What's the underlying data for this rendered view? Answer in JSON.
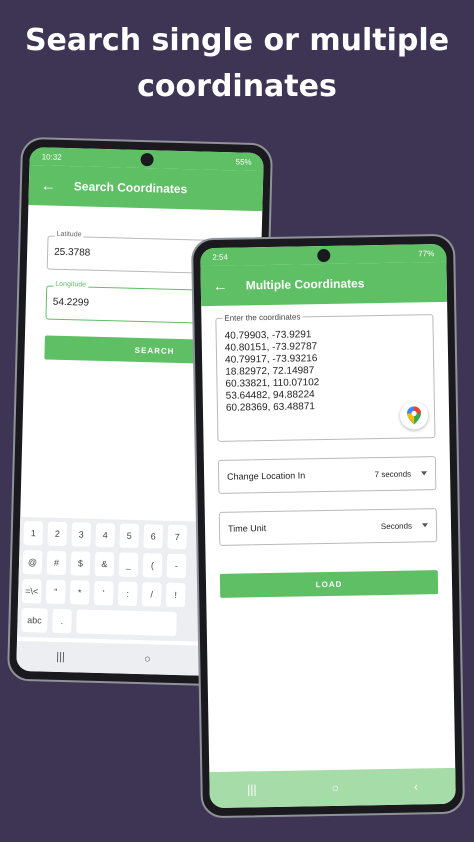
{
  "headline": {
    "line1": "Search single or multiple",
    "line2": "coordinates"
  },
  "phone1": {
    "status": {
      "time": "10:32",
      "battery": "55%"
    },
    "appbar": {
      "title": "Search Coordinates"
    },
    "latitude": {
      "label": "Latitude",
      "value": "25.3788"
    },
    "longitude": {
      "label": "Longitude",
      "value": "54.2299"
    },
    "search_label": "SEARCH",
    "keyboard": {
      "row1": [
        "1",
        "2",
        "3",
        "4",
        "5",
        "6",
        "7"
      ],
      "row2": [
        "@",
        "#",
        "$",
        "&",
        "_",
        "(",
        "-"
      ],
      "row3": [
        "=\\<",
        "\"",
        "*",
        "'",
        ":",
        "/",
        "!"
      ],
      "row4_left": "abc",
      "row4_dot": "."
    },
    "nav": {
      "recents": "|||",
      "home": "○"
    }
  },
  "phone2": {
    "status": {
      "time": "2:54",
      "battery": "77%"
    },
    "appbar": {
      "title": "Multiple Coordinates"
    },
    "coords": {
      "label": "Enter the coordinates",
      "lines": [
        "40.79903, -73.9291",
        "40.80151, -73.92787",
        "40.79917, -73.93216",
        "18.82972, 72.14987",
        "60.33821, 110.07102",
        "53.64482, 94.88224",
        "60.28369, 63.48871"
      ]
    },
    "change_location": {
      "label": "Change Location In",
      "value": "7 seconds"
    },
    "time_unit": {
      "label": "Time Unit",
      "value": "Seconds"
    },
    "load_label": "LOAD",
    "nav": {
      "recents": "|||",
      "home": "○",
      "back": "‹"
    }
  },
  "colors": {
    "accent": "#5fbf64",
    "background": "#3d3553"
  }
}
